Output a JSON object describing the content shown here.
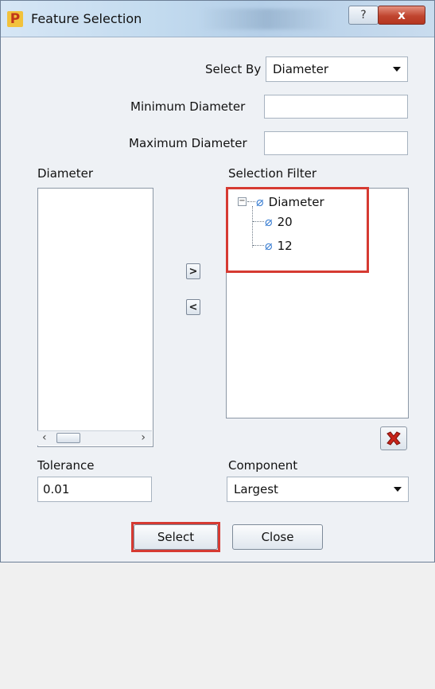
{
  "window": {
    "app_icon_letter": "P",
    "title": "Feature Selection",
    "help_label": "?",
    "close_label": "x"
  },
  "select_by": {
    "label": "Select By",
    "value": "Diameter"
  },
  "min_diameter": {
    "label": "Minimum Diameter",
    "value": ""
  },
  "max_diameter": {
    "label": "Maximum Diameter",
    "value": ""
  },
  "diameter_list": {
    "label": "Diameter",
    "scroll_left": "‹",
    "scroll_right": "›"
  },
  "transfer": {
    "add": ">",
    "remove": "<"
  },
  "selection_filter": {
    "label": "Selection Filter",
    "root": "Diameter",
    "expander": "−",
    "children": [
      "20",
      "12"
    ]
  },
  "tolerance": {
    "label": "Tolerance",
    "value": "0.01"
  },
  "component": {
    "label": "Component",
    "value": "Largest"
  },
  "buttons": {
    "select": "Select",
    "close": "Close"
  },
  "colors": {
    "highlight": "#d63a32",
    "diameter_icon": "#3c7fd2",
    "delete_icon": "#c8241a"
  },
  "icons": {
    "diameter": "diameter-icon",
    "delete": "delete-icon"
  }
}
